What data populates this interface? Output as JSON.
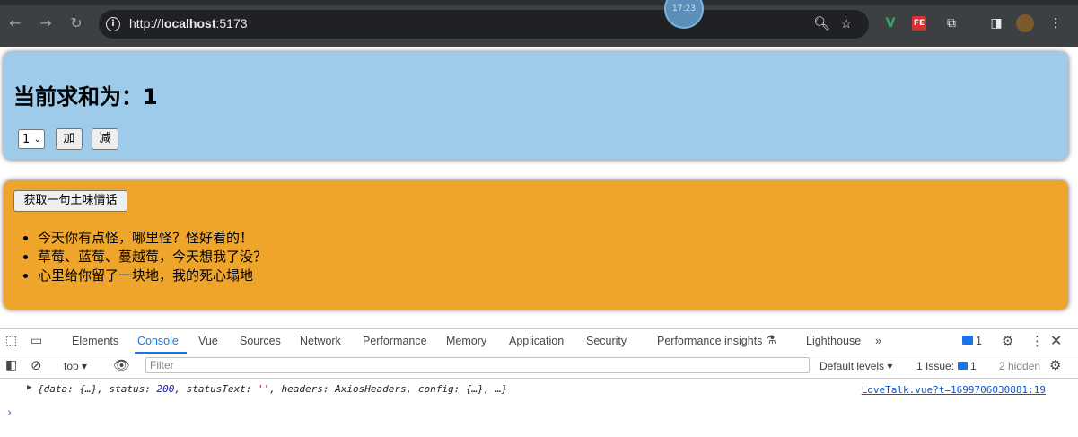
{
  "browser": {
    "url_prefix": "http://",
    "url_host": "localhost",
    "url_port": ":5173",
    "timer_badge": "17:23",
    "ext_v": "V",
    "ext_fe": "FE"
  },
  "sum_card": {
    "heading": "当前求和为：1",
    "select_value": "1",
    "add_label": "加",
    "sub_label": "减"
  },
  "love_card": {
    "button_label": "获取一句土味情话",
    "items": [
      "今天你有点怪，哪里怪？怪好看的！",
      "草莓、蓝莓、蔓越莓，今天想我了没？",
      "心里给你留了一块地，我的死心塌地"
    ]
  },
  "devtools": {
    "tabs": [
      "Elements",
      "Console",
      "Vue",
      "Sources",
      "Network",
      "Performance",
      "Memory",
      "Application",
      "Security",
      "Performance insights",
      "Lighthouse"
    ],
    "active_tab": "Console",
    "issues_badge": "1",
    "context": "top",
    "filter_placeholder": "Filter",
    "levels": "Default levels",
    "issue_label": "1 Issue:",
    "issue_count": "1",
    "hidden": "2 hidden",
    "log": {
      "p1": "{data: {…}, status: ",
      "status": "200",
      "p2": ", statusText: ",
      "status_text": "''",
      "p3": ", headers: AxiosHeaders, config: {…}, …}",
      "source": "LoveTalk.vue?t=1699706030881:19"
    },
    "prompt": "›"
  }
}
